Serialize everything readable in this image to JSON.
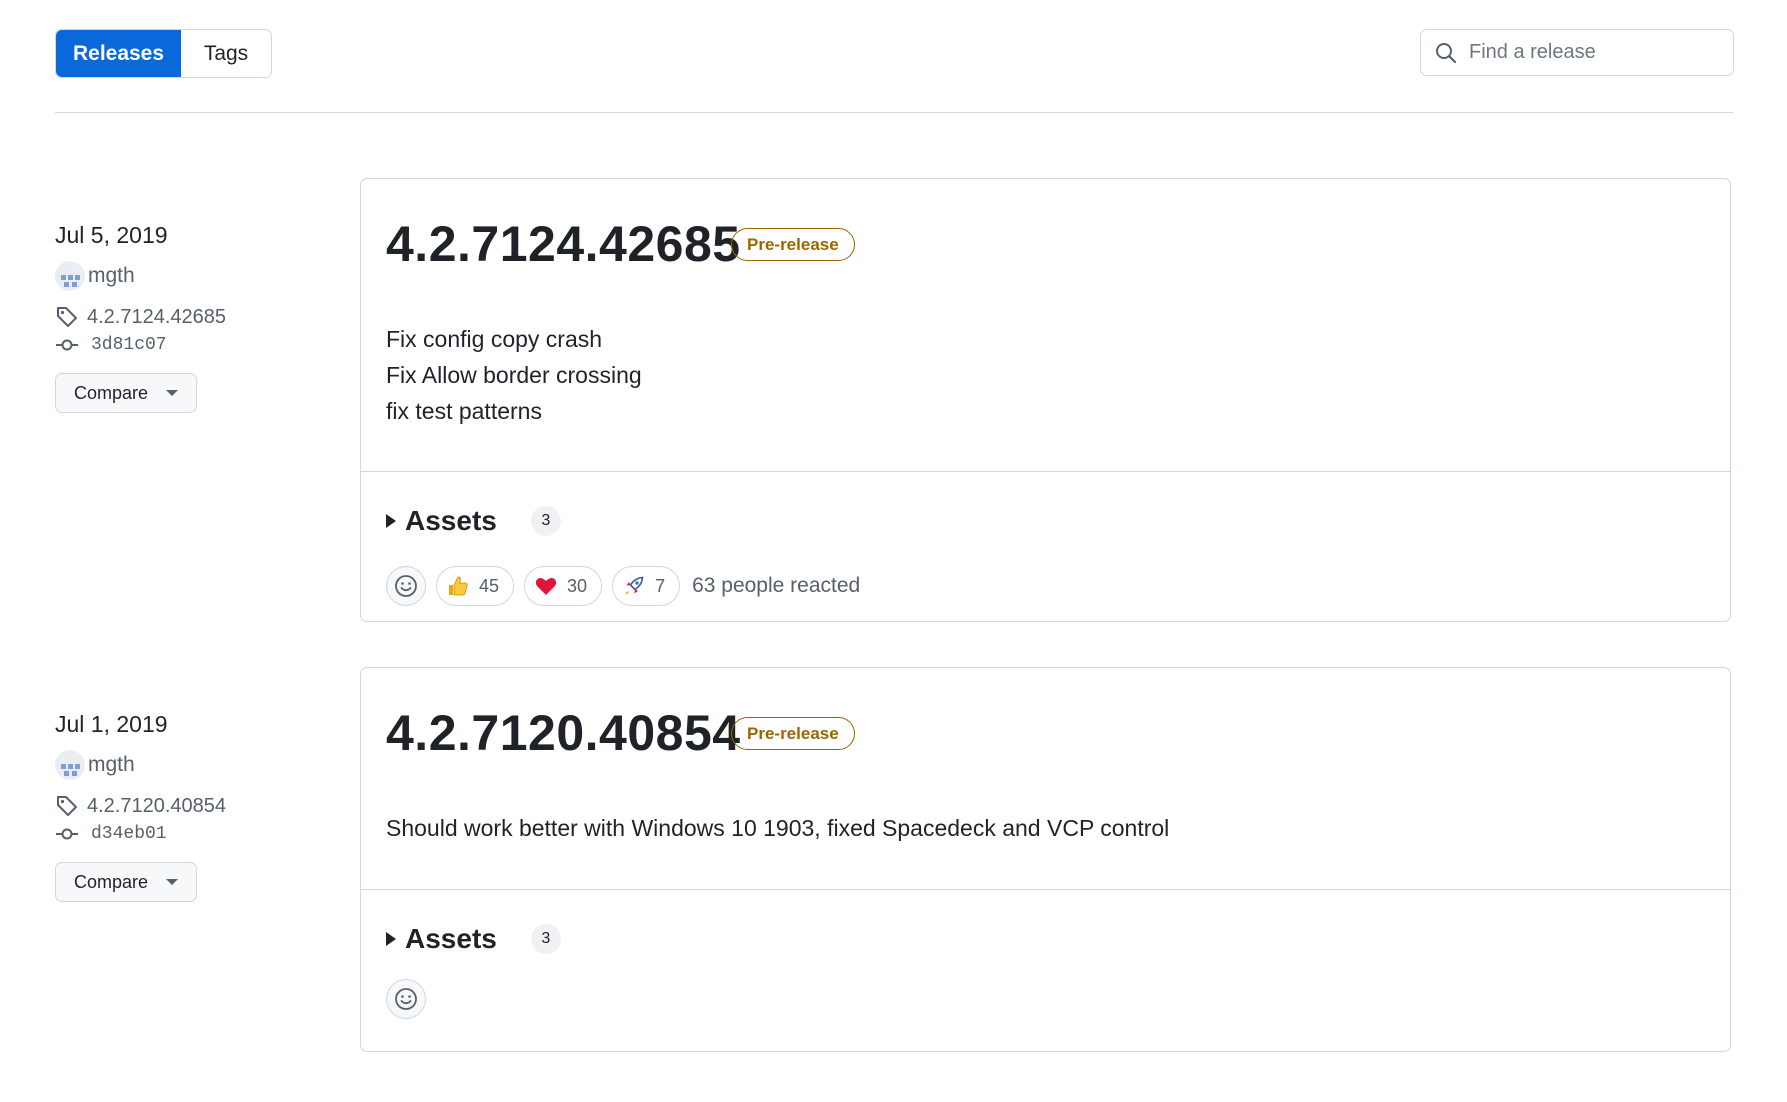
{
  "nav": {
    "tabs": [
      {
        "label": "Releases",
        "active": true
      },
      {
        "label": "Tags",
        "active": false
      }
    ],
    "search_placeholder": "Find a release"
  },
  "accent_color": "#0969da",
  "prerelease_color": "#9a6700",
  "releases": [
    {
      "date": "Jul 5, 2019",
      "author": "mgth",
      "tag": "4.2.7124.42685",
      "commit": "3d81c07",
      "compare_label": "Compare",
      "version": "4.2.7124.42685",
      "badge": "Pre-release",
      "notes": [
        "Fix config copy crash",
        "Fix Allow border crossing",
        "fix test patterns"
      ],
      "assets_label": "Assets",
      "assets_count": "3",
      "reactions": [
        {
          "icon": "thumbs-up-icon",
          "count": "45"
        },
        {
          "icon": "heart-icon",
          "count": "30"
        },
        {
          "icon": "rocket-icon",
          "count": "7"
        }
      ],
      "reacted_text": "63 people reacted"
    },
    {
      "date": "Jul 1, 2019",
      "author": "mgth",
      "tag": "4.2.7120.40854",
      "commit": "d34eb01",
      "compare_label": "Compare",
      "version": "4.2.7120.40854",
      "badge": "Pre-release",
      "notes": [
        "Should work better with Windows 10 1903, fixed Spacedeck and VCP control"
      ],
      "assets_label": "Assets",
      "assets_count": "3",
      "reactions": [],
      "reacted_text": ""
    }
  ]
}
